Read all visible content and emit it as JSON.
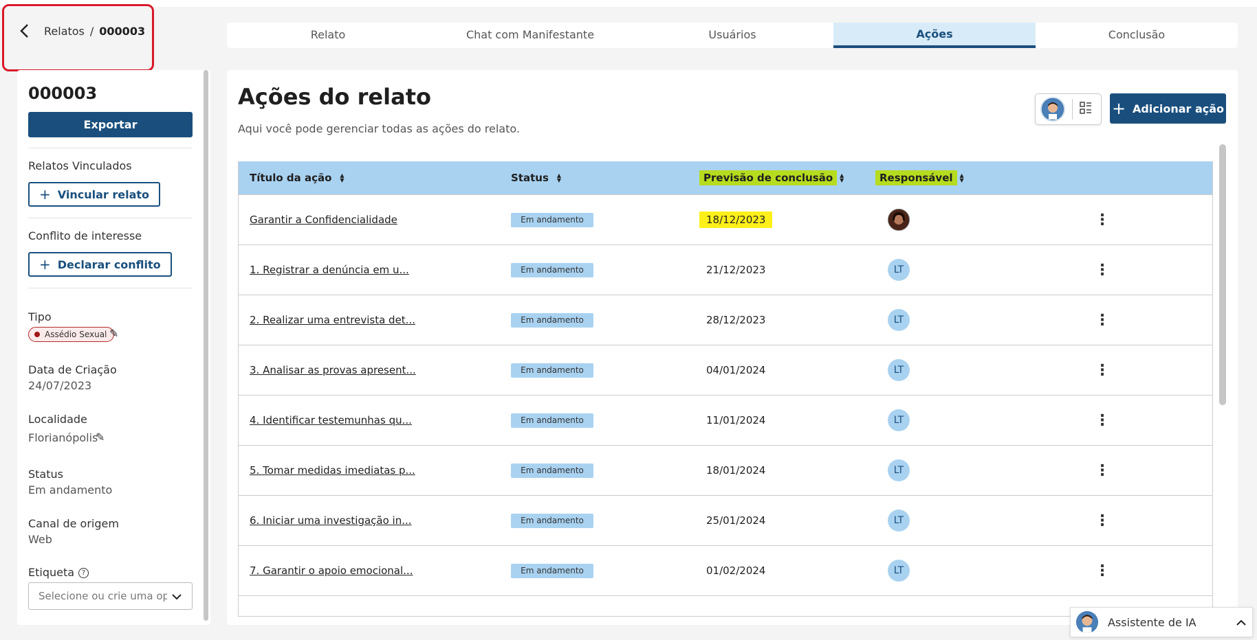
{
  "breadcrumb": {
    "parent": "Relatos",
    "separator": "/",
    "current": "000003"
  },
  "tabs": [
    {
      "label": "Relato",
      "active": false
    },
    {
      "label": "Chat com Manifestante",
      "active": false
    },
    {
      "label": "Usuários",
      "active": false
    },
    {
      "label": "Ações",
      "active": true
    },
    {
      "label": "Conclusão",
      "active": false
    }
  ],
  "sidebar": {
    "id": "000003",
    "export_label": "Exportar",
    "linked_title": "Relatos Vinculados",
    "link_button": "Vincular relato",
    "conflict_title": "Conflito de interesse",
    "conflict_button": "Declarar conflito",
    "type_label": "Tipo",
    "type_value": "Assédio Sexual",
    "created_label": "Data de Criação",
    "created_value": "24/07/2023",
    "location_label": "Localidade",
    "location_value": "Florianópolis",
    "status_label": "Status",
    "status_value": "Em andamento",
    "channel_label": "Canal de origem",
    "channel_value": "Web",
    "tag_label": "Etiqueta",
    "tag_placeholder": "Selecione ou crie uma opção"
  },
  "main": {
    "title": "Ações do relato",
    "subtitle": "Aqui você pode gerenciar todas as ações do relato.",
    "add_button": "Adicionar ação"
  },
  "table": {
    "headers": {
      "title": "Título da ação",
      "status": "Status",
      "due": "Previsão de conclusão",
      "owner": "Responsável"
    },
    "rows": [
      {
        "title": "Garantir a Confidencialidade",
        "status": "Em andamento",
        "due": "18/12/2023",
        "owner": "photo"
      },
      {
        "title": "1. Registrar a denúncia em u...",
        "status": "Em andamento",
        "due": "21/12/2023",
        "owner": "LT"
      },
      {
        "title": "2. Realizar uma entrevista det...",
        "status": "Em andamento",
        "due": "28/12/2023",
        "owner": "LT"
      },
      {
        "title": "3. Analisar as provas apresent...",
        "status": "Em andamento",
        "due": "04/01/2024",
        "owner": "LT"
      },
      {
        "title": "4. Identificar testemunhas qu...",
        "status": "Em andamento",
        "due": "11/01/2024",
        "owner": "LT"
      },
      {
        "title": "5. Tomar medidas imediatas p...",
        "status": "Em andamento",
        "due": "18/01/2024",
        "owner": "LT"
      },
      {
        "title": "6. Iniciar uma investigação in...",
        "status": "Em andamento",
        "due": "25/01/2024",
        "owner": "LT"
      },
      {
        "title": "7. Garantir o apoio emocional...",
        "status": "Em andamento",
        "due": "01/02/2024",
        "owner": "LT"
      }
    ]
  },
  "assistant": {
    "label": "Assistente de IA"
  },
  "colors": {
    "primary": "#1a4f7d",
    "header_bg": "#a9d2f1",
    "highlight_green": "#b6dc1f",
    "highlight_yellow": "#fdf01a",
    "annotation_red": "#d9192a"
  }
}
